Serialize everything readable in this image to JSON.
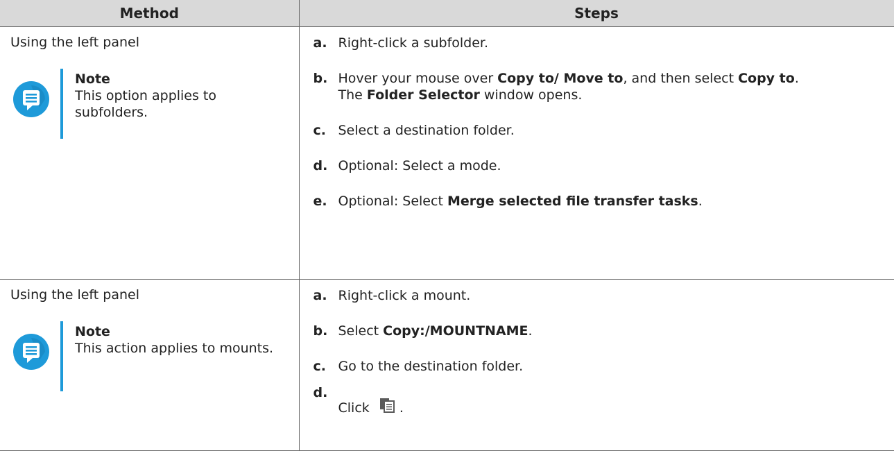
{
  "table": {
    "headers": {
      "method": "Method",
      "steps": "Steps"
    },
    "rows": [
      {
        "method": "Using the left panel",
        "note": {
          "title": "Note",
          "text": "This option applies to subfolders.",
          "icon": "note-icon"
        },
        "steps": {
          "a": {
            "label": "a.",
            "text": "Right-click a subfolder."
          },
          "b": {
            "label": "b.",
            "t1": "Hover your mouse over ",
            "b1": "Copy to/ Move to",
            "t2": ", and then select ",
            "b2": "Copy to",
            "t3": ".",
            "t4": "The ",
            "b3": "Folder Selector",
            "t5": " window opens."
          },
          "c": {
            "label": "c.",
            "text": "Select a destination folder."
          },
          "d": {
            "label": "d.",
            "text": "Optional: Select a mode."
          },
          "e": {
            "label": "e.",
            "t1": "Optional: Select ",
            "b1": "Merge selected file transfer tasks",
            "t2": "."
          }
        }
      },
      {
        "method": "Using the left panel",
        "note": {
          "title": "Note",
          "text": "This action applies to mounts.",
          "icon": "note-icon"
        },
        "steps": {
          "a": {
            "label": "a.",
            "text": "Right-click a mount."
          },
          "b": {
            "label": "b.",
            "t1": "Select ",
            "b1": "Copy:/MOUNTNAME",
            "t2": "."
          },
          "c": {
            "label": "c.",
            "text": "Go to the destination folder."
          },
          "d": {
            "label": "d.",
            "t1": "Click",
            "t2": ".",
            "icon": "copy-icon"
          }
        }
      }
    ]
  },
  "colors": {
    "accent": "#1e9ad9",
    "header_bg": "#d9d9d9",
    "border": "#666666",
    "text": "#222222"
  }
}
